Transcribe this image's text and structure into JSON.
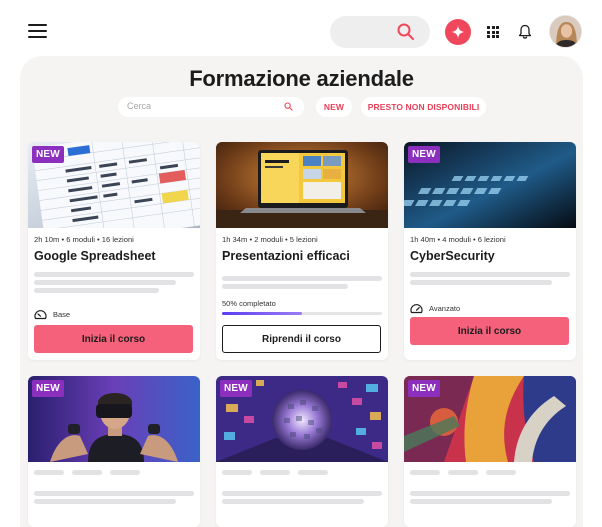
{
  "header": {
    "menu_icon": "hamburger-menu-icon",
    "search_icon": "search-icon",
    "ai_icon": "sparkle-icon",
    "apps_icon": "grid-icon",
    "notifications_icon": "bell-icon",
    "accent_color": "#f0475c"
  },
  "page": {
    "title": "Formazione aziendale"
  },
  "filters": {
    "search_placeholder": "Cerca",
    "chips": [
      "NEW",
      "PRESTO NON DISPONIBILI"
    ]
  },
  "courses": [
    {
      "badge": "NEW",
      "meta": "2h 10m • 6 moduli • 16 lezioni",
      "title": "Google Spreadsheet",
      "level": "Base",
      "action": "Inizia il corso"
    },
    {
      "badge": "",
      "meta": "1h 34m • 2 moduli • 5 lezioni",
      "title": "Presentazioni efficaci",
      "progress_label": "50% completato",
      "progress": 0.5,
      "action": "Riprendi il corso"
    },
    {
      "badge": "NEW",
      "meta": "1h 40m • 4 moduli • 6 lezioni",
      "title": "CyberSecurity",
      "level": "Avanzato",
      "action": "Inizia il corso"
    },
    {
      "badge": "NEW"
    },
    {
      "badge": "NEW"
    },
    {
      "badge": "NEW"
    }
  ]
}
